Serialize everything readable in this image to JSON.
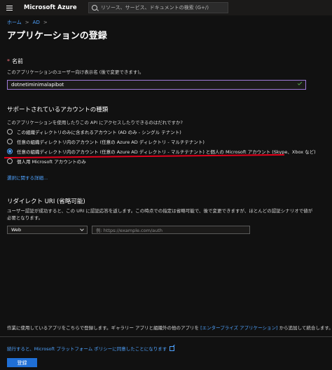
{
  "topbar": {
    "brand": "Microsoft Azure",
    "search_placeholder": "リソース、サービス、ドキュメントの検索 (G+/)"
  },
  "breadcrumb": {
    "home": "ホーム",
    "sep1": ">",
    "ad": "AD",
    "sep2": ">"
  },
  "page": {
    "title": "アプリケーションの登録",
    "more": "···"
  },
  "name_section": {
    "required_mark": "*",
    "label": "名前",
    "description": "このアプリケーションのユーザー向け表示名 (後で変更できます)。",
    "value": "dotnetiminimalapibot"
  },
  "account_types": {
    "heading": "サポートされているアカウントの種類",
    "question": "このアプリケーションを使用したりこの API にアクセスしたりできるのはだれですか?",
    "options": [
      {
        "label": "この組織ディレクトリのみに含まれるアカウント (AD のみ - シングル テナント)",
        "selected": false
      },
      {
        "label": "任意の組織ディレクトリ内のアカウント (任意の Azure AD ディレクトリ - マルチテナント)",
        "selected": false
      },
      {
        "label": "任意の組織ディレクトリ内のアカウント (任意の Azure AD ディレクトリ - マルチテナント) と個人の Microsoft アカウント (Skype、Xbox など)",
        "selected": true
      },
      {
        "label": "個人用 Microsoft アカウントのみ",
        "selected": false
      }
    ],
    "help_link": "選択に関する詳細..."
  },
  "redirect": {
    "heading": "リダイレクト URI (省略可能)",
    "desc_line1": "ユーザー認証が成功すると、この URI に認証応答を返します。この時点での指定は省略可能で、後で変更できますが、ほとんどの認証シナリオで値が必要となります。",
    "platform": "Web",
    "uri_placeholder": "例: https://example.com/auth"
  },
  "footer": {
    "note_prefix": "作業に使用しているアプリをこちらで登録します。ギャラリー アプリと組織外の他のアプリを ",
    "note_link": "[エンタープライズ アプリケーション]",
    "note_suffix": " から追加して統合します。",
    "policy_link": "続行すると、Microsoft プラットフォーム ポリシーに同意したことになります",
    "register_label": "登録"
  },
  "colors": {
    "accent": "#4fa3ff",
    "button": "#1f6fd6",
    "annotation": "#e3001b"
  }
}
